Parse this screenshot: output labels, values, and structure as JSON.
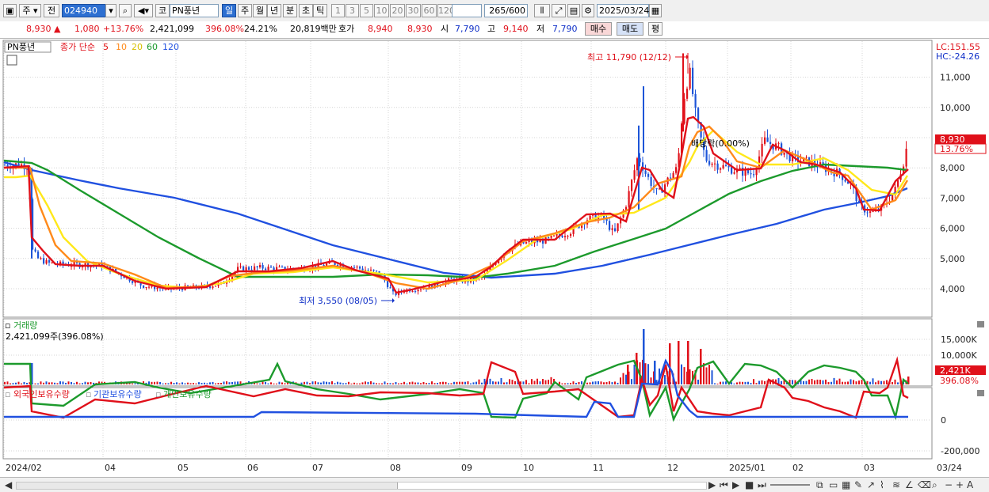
{
  "toolbar": {
    "period_select": "주",
    "prev_label": "전",
    "code": "024940",
    "market": "코",
    "name": "PN풍년",
    "tabs": [
      "일",
      "주",
      "월",
      "년",
      "분",
      "초",
      "틱"
    ],
    "intervals": [
      "1",
      "3",
      "5",
      "10",
      "20",
      "30",
      "60",
      "120"
    ],
    "count_value": "265",
    "count_max": "/600",
    "date": "2025/03/24"
  },
  "quote": {
    "price": "8,930",
    "change": "1,080",
    "change_pct": "+13.76%",
    "volume": "2,421,099",
    "volume_ratio": "396.08%",
    "turnover": "24.21%",
    "amount": "20,819백만",
    "bid_label": "호가",
    "bid_price": "8,940",
    "ask_price": "8,930",
    "open_label": "시",
    "open": "7,790",
    "high_label": "고",
    "high": "9,140",
    "low_label": "저",
    "low": "7,790",
    "buy_label": "매수",
    "sell_label": "매도",
    "eval_label": "평"
  },
  "price_panel": {
    "legend": {
      "name": "PN풍년",
      "type": "종가 단순",
      "ma": [
        "5",
        "10",
        "20",
        "60",
        "120"
      ]
    },
    "lc_label": "LC:151.55",
    "hc_label": "HC:-24.26",
    "current_price_box": "8,930",
    "current_pct_box": "13.76%",
    "high_annotation": "최고 11,790 (12/12)",
    "low_annotation": "최저 3,550 (08/05)",
    "mid_annotation": "배당락(0.00%)",
    "y_ticks": [
      "11,000",
      "10,000",
      "9,000",
      "8,000",
      "7,000",
      "6,000",
      "5,000",
      "4,000"
    ],
    "colors": {
      "candle_up": "#e0101a",
      "candle_down": "#1d55d8",
      "ma5": "#e01010",
      "ma10": "#ff8a1a",
      "ma20": "#ffe81a",
      "ma60": "#1c9a2c",
      "ma120": "#2050e0"
    }
  },
  "volume_panel": {
    "title": "거래량",
    "value_label": "2,421,099주(396.08%)",
    "y_ticks": [
      "15,000K",
      "10,000K"
    ],
    "current_box": "2,421K",
    "current_pct": "396.08%"
  },
  "holding_panel": {
    "legend": [
      "외국인보유수량",
      "기관보유수량",
      "개인보유수량"
    ],
    "y_ticks": [
      "0",
      "-200,000"
    ],
    "colors": [
      "#e0101a",
      "#2050e0",
      "#1c9a2c"
    ]
  },
  "x_axis": [
    "2024/02",
    "04",
    "05",
    "06",
    "07",
    "08",
    "09",
    "10",
    "11",
    "12",
    "2025/01",
    "02",
    "03",
    "03/24"
  ]
}
